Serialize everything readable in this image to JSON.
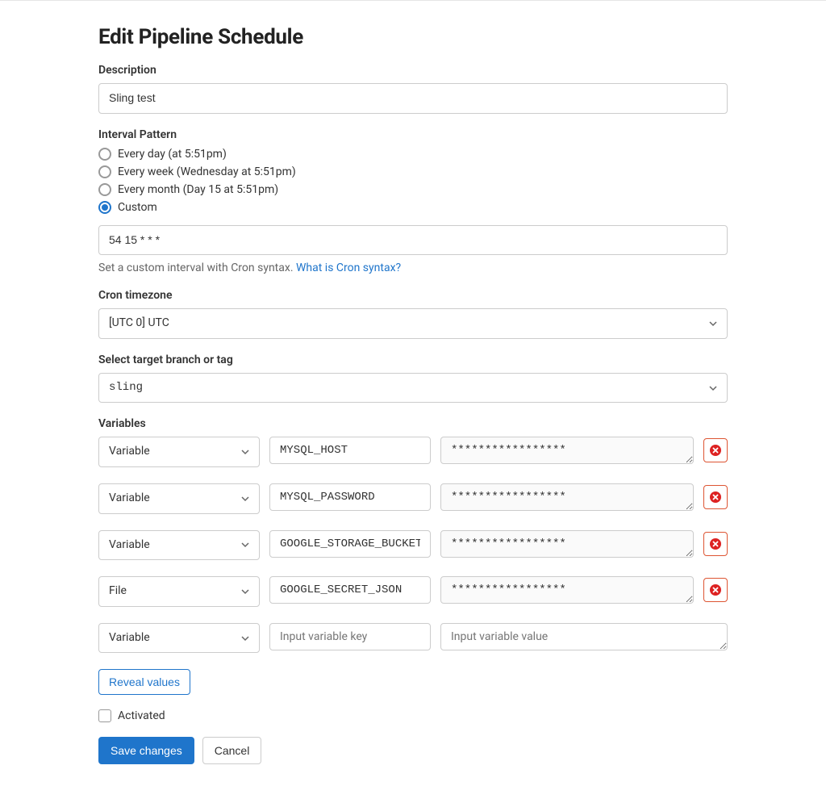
{
  "page": {
    "title": "Edit Pipeline Schedule"
  },
  "description": {
    "label": "Description",
    "value": "Sling test"
  },
  "interval": {
    "label": "Interval Pattern",
    "options": {
      "daily": "Every day (at 5:51pm)",
      "weekly": "Every week (Wednesday at 5:51pm)",
      "monthly": "Every month (Day 15 at 5:51pm)",
      "custom": "Custom"
    },
    "selected": "custom",
    "custom_value": "54 15 * * *",
    "help_prefix": "Set a custom interval with Cron syntax. ",
    "help_link": "What is Cron syntax?"
  },
  "timezone": {
    "label": "Cron timezone",
    "value": "[UTC 0] UTC"
  },
  "target": {
    "label": "Select target branch or tag",
    "value": "sling"
  },
  "variables": {
    "label": "Variables",
    "type_variable": "Variable",
    "type_file": "File",
    "rows": [
      {
        "type": "Variable",
        "key": "MYSQL_HOST",
        "value": "*****************"
      },
      {
        "type": "Variable",
        "key": "MYSQL_PASSWORD",
        "value": "*****************"
      },
      {
        "type": "Variable",
        "key": "GOOGLE_STORAGE_BUCKET",
        "value": "*****************"
      },
      {
        "type": "File",
        "key": "GOOGLE_SECRET_JSON",
        "value": "*****************"
      }
    ],
    "empty_key_placeholder": "Input variable key",
    "empty_value_placeholder": "Input variable value",
    "reveal_label": "Reveal values"
  },
  "activated": {
    "label": "Activated",
    "checked": false
  },
  "actions": {
    "save": "Save changes",
    "cancel": "Cancel"
  }
}
